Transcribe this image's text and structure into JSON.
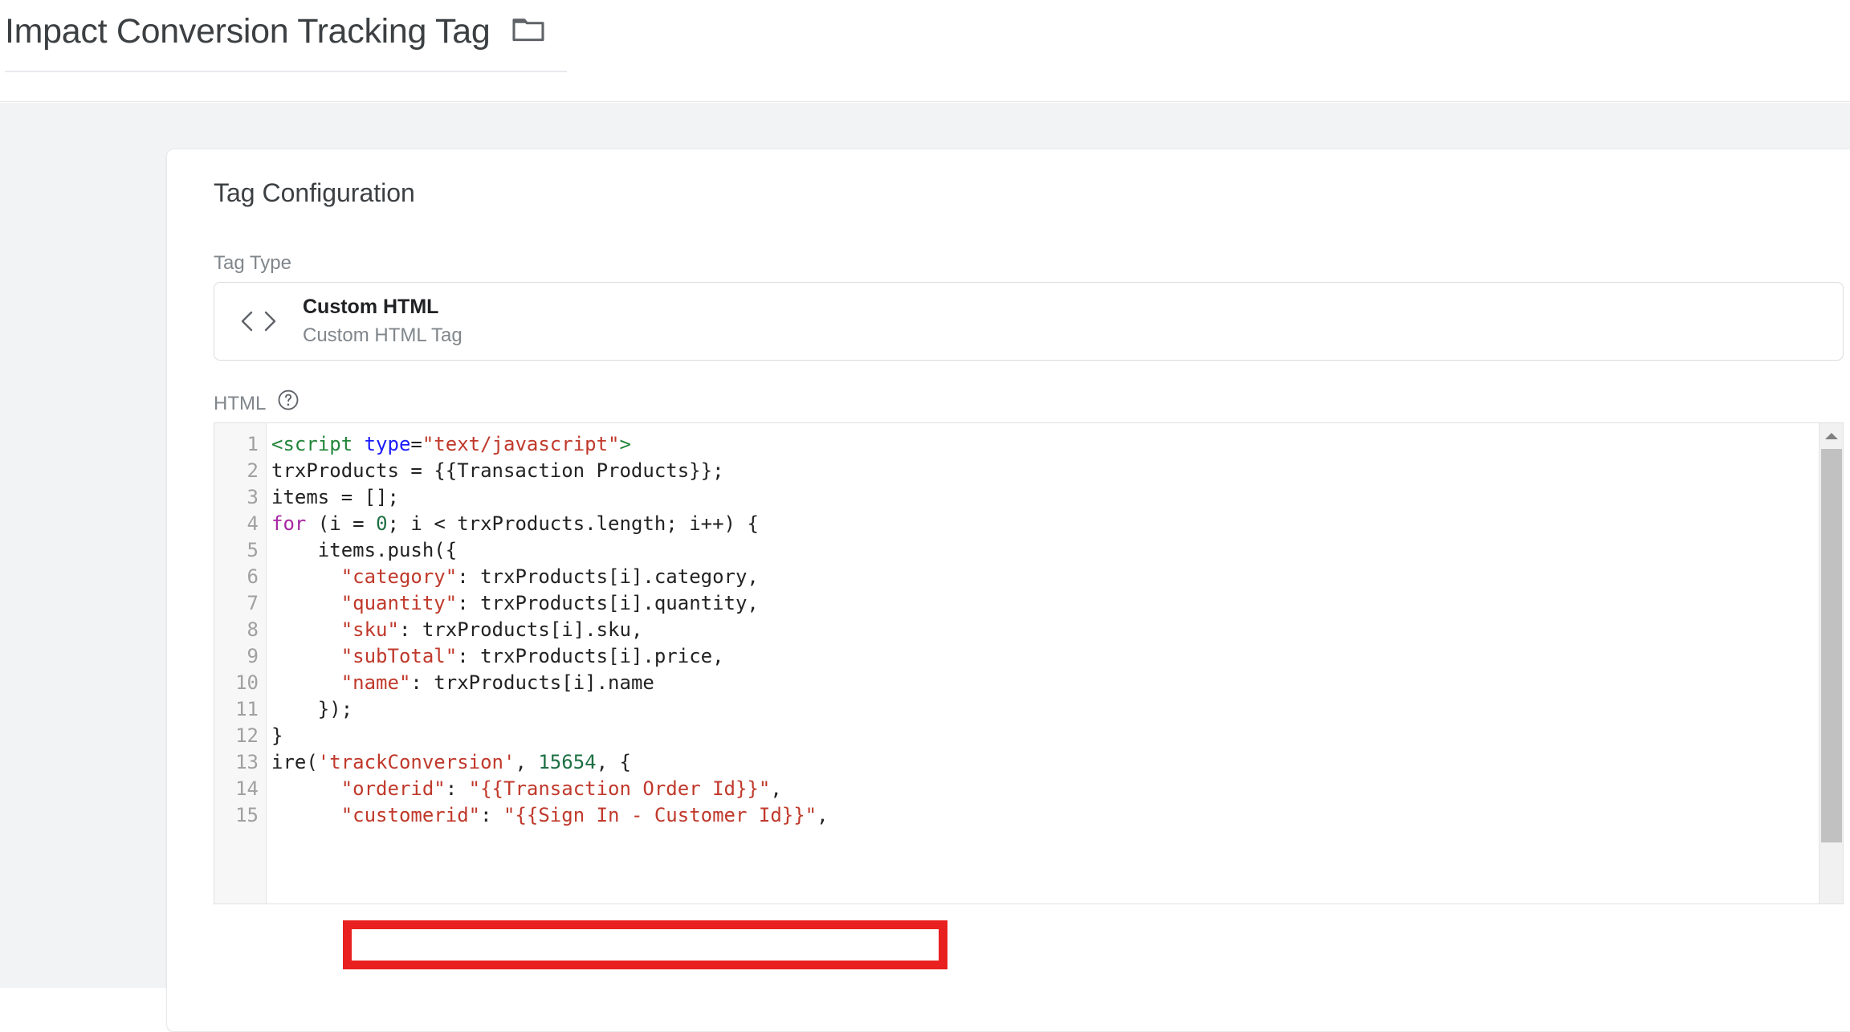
{
  "header": {
    "tag_title": "Impact Conversion Tracking Tag",
    "folder_icon": "folder-icon"
  },
  "card": {
    "section_title": "Tag Configuration",
    "tag_type_label": "Tag Type",
    "html_label": "HTML",
    "help_icon": "help-circle-icon",
    "tag_type": {
      "icon": "code-brackets-icon",
      "name": "Custom HTML",
      "description": "Custom HTML Tag"
    }
  },
  "editor": {
    "line_numbers": [
      "1",
      "2",
      "3",
      "4",
      "5",
      "6",
      "7",
      "8",
      "9",
      "10",
      "11",
      "12",
      "13",
      "14",
      "15"
    ],
    "lines": [
      {
        "n": "1",
        "text": "<script type=\"text/javascript\">"
      },
      {
        "n": "2",
        "text": "trxProducts = {{Transaction Products}};"
      },
      {
        "n": "3",
        "text": "items = [];"
      },
      {
        "n": "4",
        "text": "for (i = 0; i < trxProducts.length; i++) {"
      },
      {
        "n": "5",
        "text": "    items.push({"
      },
      {
        "n": "6",
        "text": "      \"category\": trxProducts[i].category,"
      },
      {
        "n": "7",
        "text": "      \"quantity\": trxProducts[i].quantity,"
      },
      {
        "n": "8",
        "text": "      \"sku\": trxProducts[i].sku,"
      },
      {
        "n": "9",
        "text": "      \"subTotal\": trxProducts[i].price,"
      },
      {
        "n": "10",
        "text": "      \"name\": trxProducts[i].name"
      },
      {
        "n": "11",
        "text": "    });"
      },
      {
        "n": "12",
        "text": "}"
      },
      {
        "n": "13",
        "text": "ire('trackConversion', 15654, {"
      },
      {
        "n": "14",
        "text": "      \"orderid\": \"{{Transaction Order Id}}\","
      },
      {
        "n": "15",
        "text": "      \"customerid\": \"{{Sign In - Customer Id}}\","
      }
    ],
    "scrollbar": {
      "up_arrow_icon": "scroll-up-arrow-icon"
    }
  },
  "annotation": {
    "highlight_color": "#e8201f",
    "highlighted_line": "      \"orderid\": \"{{Transaction Order Id}}\","
  },
  "colors": {
    "page_background": "#f1f3f4",
    "card_background": "#ffffff",
    "text_primary": "#3c4043",
    "text_secondary": "#80868b",
    "annotation_red": "#e8201f"
  }
}
